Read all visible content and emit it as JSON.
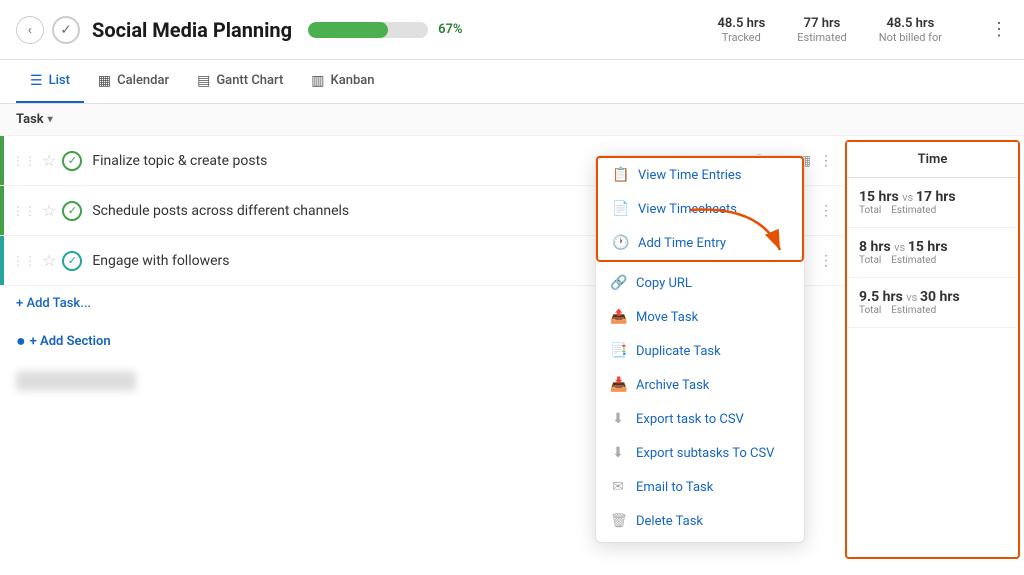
{
  "header": {
    "back_label": "‹",
    "check_icon": "✓",
    "title": "Social Media Planning",
    "progress_pct": 67,
    "progress_label": "67%",
    "stats": [
      {
        "value": "48.5 hrs",
        "label": "Tracked"
      },
      {
        "value": "77 hrs",
        "label": "Estimated"
      },
      {
        "value": "48.5 hrs",
        "label": "Not billed for"
      }
    ],
    "more_icon": "⋮"
  },
  "tabs": [
    {
      "id": "list",
      "label": "List",
      "icon": "☰",
      "active": true
    },
    {
      "id": "calendar",
      "label": "Calendar",
      "icon": "▦",
      "active": false
    },
    {
      "id": "gantt",
      "label": "Gantt Chart",
      "icon": "▤",
      "active": false
    },
    {
      "id": "kanban",
      "label": "Kanban",
      "icon": "▥",
      "active": false
    }
  ],
  "toolbar": {
    "task_dropdown_label": "Task",
    "dropdown_arrow": "▾"
  },
  "tasks": [
    {
      "name": "Finalize topic & create posts",
      "status_icon": "✓",
      "status_color": "green",
      "bar_color": "red",
      "time_total": "15 hrs",
      "time_estimated": "17 hrs"
    },
    {
      "name": "Schedule posts across different channels",
      "status_icon": "✓",
      "status_color": "green",
      "bar_color": "green",
      "time_total": "8 hrs",
      "time_estimated": "15 hrs"
    },
    {
      "name": "Engage with followers",
      "status_icon": "✓",
      "status_color": "teal",
      "bar_color": "teal",
      "time_total": "9.5 hrs",
      "time_estimated": "30 hrs"
    }
  ],
  "time_column": {
    "header": "Time"
  },
  "add_task_label": "+ Add Task...",
  "add_section_label": "+ Add Section",
  "context_menu": {
    "highlighted_items": [
      {
        "id": "view-time-entries",
        "icon": "📋",
        "label": "View Time Entries"
      },
      {
        "id": "view-timesheets",
        "icon": "📄",
        "label": "View Timesheets"
      },
      {
        "id": "add-time-entry",
        "icon": "🕐",
        "label": "Add Time Entry"
      }
    ],
    "lower_items": [
      {
        "id": "copy-url",
        "icon": "🔗",
        "label": "Copy URL"
      },
      {
        "id": "move-task",
        "icon": "📤",
        "label": "Move Task"
      },
      {
        "id": "duplicate-task",
        "icon": "📑",
        "label": "Duplicate Task"
      },
      {
        "id": "archive-task",
        "icon": "📥",
        "label": "Archive Task"
      },
      {
        "id": "export-csv",
        "icon": "⬇",
        "label": "Export task to CSV"
      },
      {
        "id": "export-subtasks-csv",
        "icon": "⬇",
        "label": "Export subtasks To CSV"
      },
      {
        "id": "email-task",
        "icon": "✉",
        "label": "Email to Task"
      },
      {
        "id": "delete-task",
        "icon": "🗑",
        "label": "Delete Task"
      }
    ]
  },
  "colors": {
    "accent_blue": "#1565c0",
    "orange_highlight": "#e65100",
    "green": "#43a047",
    "teal": "#26a69a",
    "red": "#e53935"
  }
}
